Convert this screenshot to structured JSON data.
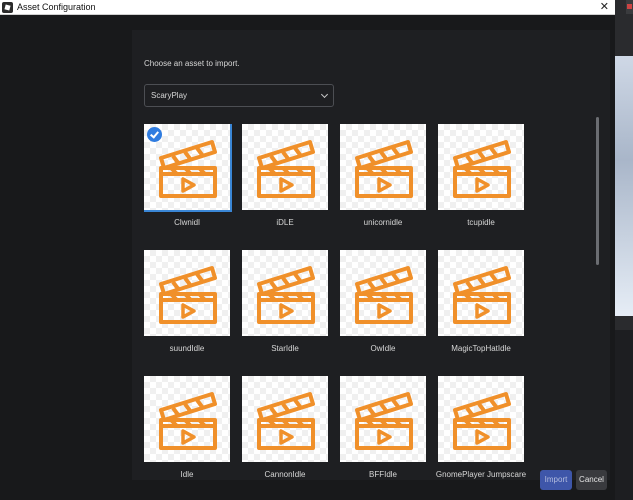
{
  "window": {
    "title": "Asset Configuration",
    "close_glyph": "✕"
  },
  "prompt": "Choose an asset to import.",
  "dropdown": {
    "selected": "ScaryPlay"
  },
  "assets": [
    {
      "label": "Clwnidl",
      "selected": true
    },
    {
      "label": "iDLE",
      "selected": false
    },
    {
      "label": "unicornidle",
      "selected": false
    },
    {
      "label": "tcupidle",
      "selected": false
    },
    {
      "label": "suundIdle",
      "selected": false
    },
    {
      "label": "StarIdle",
      "selected": false
    },
    {
      "label": "OwIdle",
      "selected": false
    },
    {
      "label": "MagicTopHatIdle",
      "selected": false
    },
    {
      "label": "Idle",
      "selected": false
    },
    {
      "label": "CannonIdle",
      "selected": false
    },
    {
      "label": "BFFIdle",
      "selected": false
    },
    {
      "label": "GnomePlayer Jumpscare",
      "selected": false
    }
  ],
  "buttons": {
    "import": "Import",
    "cancel": "Cancel"
  },
  "colors": {
    "accent": "#2f7ce0",
    "clapper": "#f0902a",
    "import_bg": "#3e56a9"
  },
  "icons": {
    "tile_icon": "clapperboard-video-icon",
    "check": "checkmark-icon",
    "dropdown": "chevron-down-icon"
  }
}
